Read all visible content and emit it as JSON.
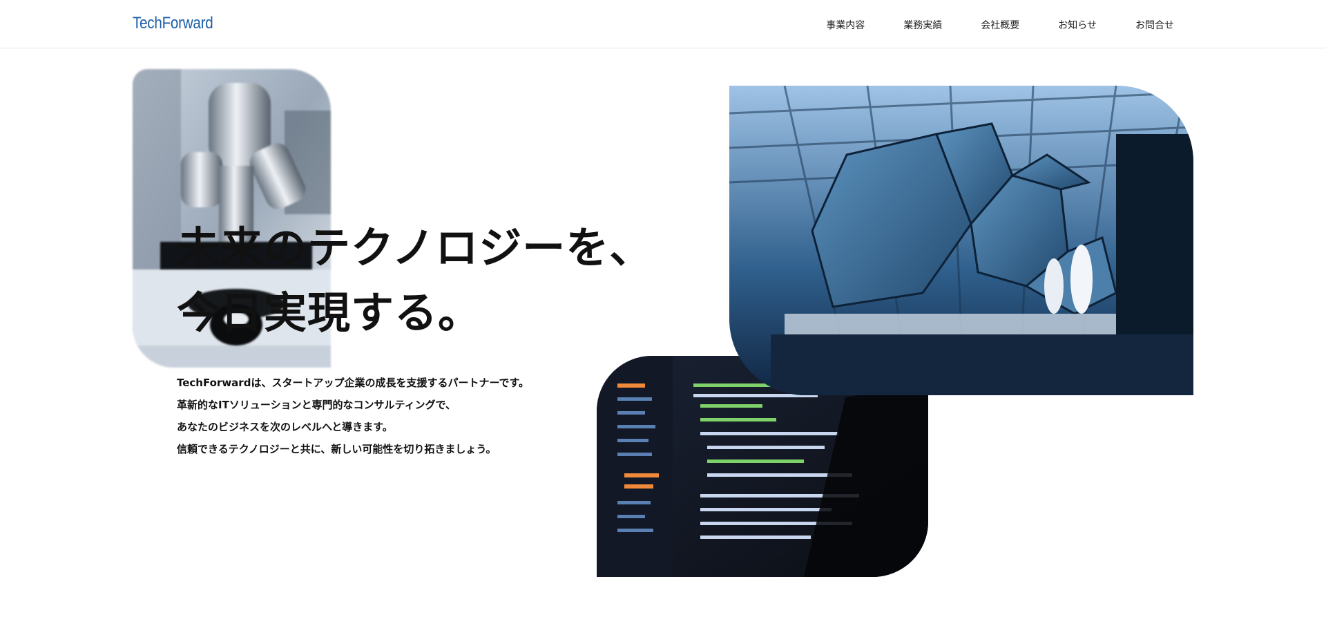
{
  "header": {
    "logo": "TechForward",
    "nav": [
      {
        "label": "事業内容"
      },
      {
        "label": "業務実績"
      },
      {
        "label": "会社概要"
      },
      {
        "label": "お知らせ"
      },
      {
        "label": "お問合せ"
      }
    ]
  },
  "hero": {
    "title_line1": "未来のテクノロジーを、",
    "title_line2": "今日実現する。",
    "description": [
      "TechForwardは、スタートアップ企業の成長を支援するパートナーです。",
      "革新的なITソリューションと専門的なコンサルティングで、",
      "あなたのビジネスを次のレベルへと導きます。",
      "信頼できるテクノロジーと共に、新しい可能性を切り拓きましょう。"
    ]
  },
  "images": {
    "microscope": "microscope-photo",
    "space_mirror": "telescope-mirror-photo",
    "code_laptop": "code-laptop-photo"
  },
  "colors": {
    "brand": "#1c5ea8",
    "text": "#111111",
    "border": "#e6e6e6"
  }
}
